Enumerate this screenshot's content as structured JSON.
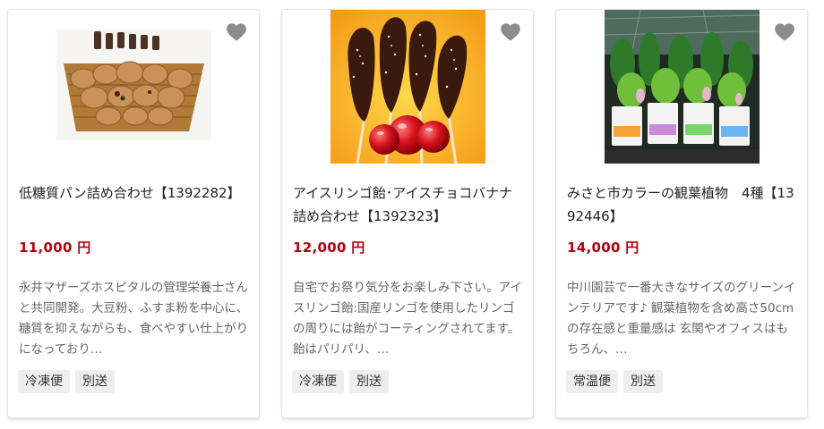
{
  "products": [
    {
      "image_label": "low-sugar bread basket",
      "title": "低糖質パン詰め合わせ【1392282】",
      "price": "11,000 円",
      "description": "永井マザーズホスピタルの管理栄養士さんと共同開発。大豆粉、ふすま粉を中心に、糖質を抑えながらも、食べやすい仕上がりになっており…",
      "tags": [
        "冷凍便",
        "別送"
      ]
    },
    {
      "image_label": "chocolate bananas and candy apples",
      "title": "アイスリンゴ飴･アイスチョコバナナ詰め合わせ【1392323】",
      "price": "12,000 円",
      "description": "自宅でお祭り気分をお楽しみ下さい。アイスリンゴ飴:国産リンゴを使用したリンゴの周りには飴がコーティングされてます。飴はパリパリ、…",
      "tags": [
        "冷凍便",
        "別送"
      ]
    },
    {
      "image_label": "colorful foliage plants in pots",
      "title": "みさと市カラーの観葉植物　4種【1392446】",
      "price": "14,000 円",
      "description": "中川園芸で一番大きなサイズのグリーンインテリアです♪ 観葉植物を含め高さ50cmの存在感と重量感は 玄関やオフィスはもちろん、…",
      "tags": [
        "常温便",
        "別送"
      ]
    }
  ],
  "colors": {
    "price": "#b3000f",
    "heart": "#8c8c8c",
    "tag_bg": "#eeeeee"
  },
  "icons": {
    "favorite": "heart-icon"
  }
}
